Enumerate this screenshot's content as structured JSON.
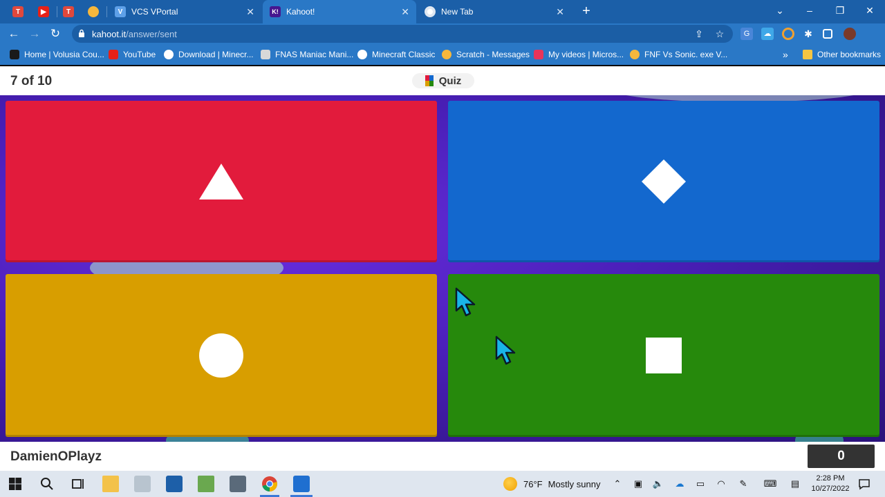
{
  "browser": {
    "tabs": [
      {
        "label": "",
        "icon": "tynker-icon",
        "pinned": true
      },
      {
        "label": "",
        "icon": "youtube-icon",
        "pinned": true
      },
      {
        "label": "",
        "icon": "tynker-icon",
        "pinned": true
      },
      {
        "label": "",
        "icon": "scratch-icon",
        "pinned": true
      },
      {
        "label": "VCS VPortal",
        "icon": "vportal-icon"
      },
      {
        "label": "Kahoot!",
        "icon": "kahoot-icon",
        "active": true
      },
      {
        "label": "New Tab",
        "icon": "chrome-icon"
      }
    ],
    "url_host": "kahoot.it",
    "url_path": "/answer/sent",
    "bookmarks": [
      {
        "label": "Home | Volusia Cou...",
        "icon": "folder-icon"
      },
      {
        "label": "YouTube",
        "icon": "youtube-icon"
      },
      {
        "label": "Download | Minecr...",
        "icon": "globe-icon"
      },
      {
        "label": "FNAS Maniac Mani...",
        "icon": "laptop-icon"
      },
      {
        "label": "Minecraft Classic",
        "icon": "globe-icon"
      },
      {
        "label": "Scratch - Messages",
        "icon": "scratch-icon"
      },
      {
        "label": "My videos | Micros...",
        "icon": "stream-icon"
      },
      {
        "label": "FNF Vs Sonic. exe V...",
        "icon": "scratch-icon"
      }
    ],
    "overflow_label": "»",
    "other_bookmarks_label": "Other bookmarks"
  },
  "kahoot": {
    "question_counter": "7 of 10",
    "mode_label": "Quiz",
    "answers": [
      {
        "color": "#e21b3c",
        "shape": "triangle"
      },
      {
        "color": "#1368ce",
        "shape": "diamond"
      },
      {
        "color": "#d89e00",
        "shape": "circle"
      },
      {
        "color": "#26890c",
        "shape": "square"
      }
    ],
    "player_name": "DamienOPlayz",
    "score": "0"
  },
  "taskbar": {
    "weather_temp": "76°F",
    "weather_condition": "Mostly sunny",
    "time": "2:28 PM",
    "date": "10/27/2022"
  }
}
